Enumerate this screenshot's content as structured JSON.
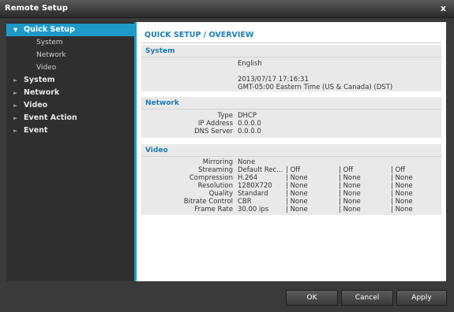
{
  "window": {
    "title": "Remote Setup",
    "close_label": "x"
  },
  "sidebar": {
    "items": [
      {
        "label": "Quick Setup",
        "arrow": "▼",
        "active": true,
        "children": [
          "System",
          "Network",
          "Video"
        ]
      },
      {
        "label": "System",
        "arrow": "►"
      },
      {
        "label": "Network",
        "arrow": "►"
      },
      {
        "label": "Video",
        "arrow": "►"
      },
      {
        "label": "Event Action",
        "arrow": "►"
      },
      {
        "label": "Event",
        "arrow": "►"
      }
    ]
  },
  "content": {
    "title": "QUICK SETUP / OVERVIEW",
    "system": {
      "heading": "System",
      "language": "English",
      "datetime": "2013/07/17 17:16:31",
      "timezone": "GMT-05:00 Eastern Time (US & Canada) (DST)"
    },
    "network": {
      "heading": "Network",
      "rows": [
        {
          "label": "Type",
          "value": "DHCP"
        },
        {
          "label": "IP Address",
          "value": "0.0.0.0"
        },
        {
          "label": "DNS Server",
          "value": "0.0.0.0"
        }
      ]
    },
    "video": {
      "heading": "Video",
      "rows": [
        {
          "label": "Mirroring",
          "values": [
            "None",
            "",
            "",
            ""
          ]
        },
        {
          "label": "Streaming",
          "values": [
            "Default Rec...",
            "| Off",
            "| Off",
            "| Off"
          ]
        },
        {
          "label": "Compression",
          "values": [
            "H.264",
            "| None",
            "| None",
            "| None"
          ]
        },
        {
          "label": "Resolution",
          "values": [
            "1280X720",
            "| None",
            "| None",
            "| None"
          ]
        },
        {
          "label": "Quality",
          "values": [
            "Standard",
            "| None",
            "| None",
            "| None"
          ]
        },
        {
          "label": "Bitrate Control",
          "values": [
            "CBR",
            "| None",
            "| None",
            "| None"
          ]
        },
        {
          "label": "Frame Rate",
          "values": [
            "30.00 ips",
            "| None",
            "| None",
            "| None"
          ]
        }
      ]
    }
  },
  "footer": {
    "ok": "OK",
    "cancel": "Cancel",
    "apply": "Apply"
  },
  "colors": {
    "accent": "#1e9ac8",
    "heading": "#1e7bb0",
    "panel": "#2f2f2f"
  }
}
